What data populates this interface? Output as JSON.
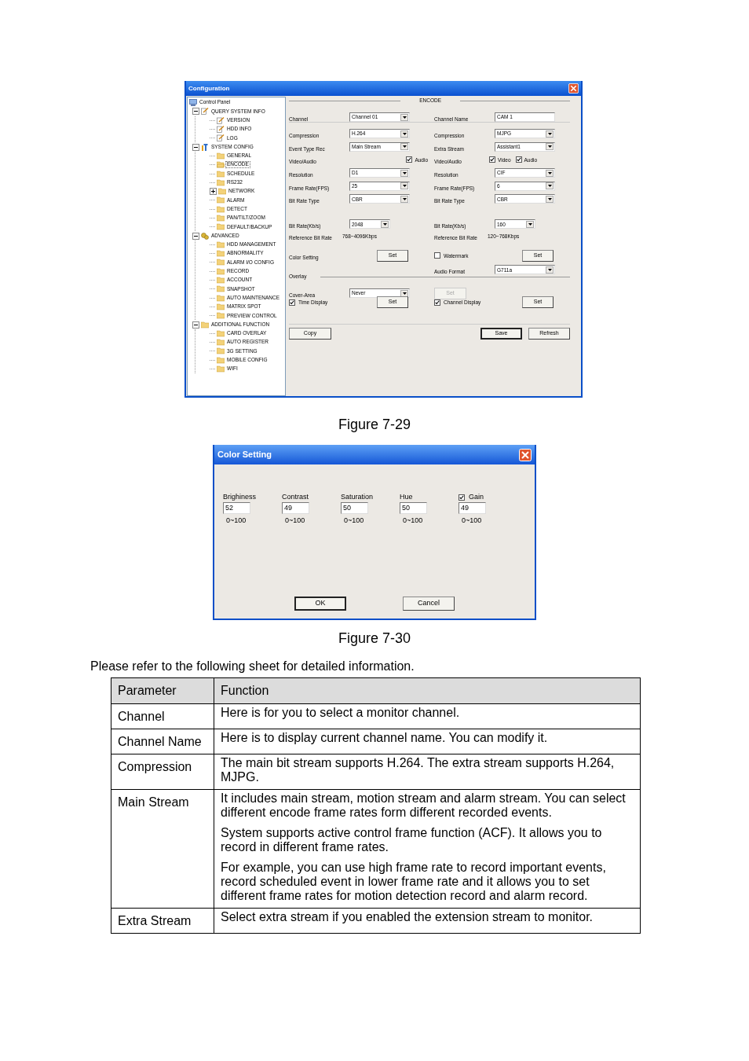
{
  "config_window": {
    "title": "Configuration",
    "tree": [
      {
        "label": "Control Panel",
        "kind": "monitor",
        "selected": false,
        "children": [
          {
            "label": "QUERY SYSTEM INFO",
            "kind": "doc",
            "expanded": true,
            "selected": false,
            "children": [
              {
                "label": "VERSION",
                "kind": "doc",
                "selected": false
              },
              {
                "label": "HDD INFO",
                "kind": "doc",
                "selected": false
              },
              {
                "label": "LOG",
                "kind": "doc",
                "selected": false
              }
            ]
          },
          {
            "label": "SYSTEM CONFIG",
            "kind": "tool",
            "expanded": true,
            "selected": false,
            "children": [
              {
                "label": "GENERAL",
                "kind": "folder",
                "selected": false
              },
              {
                "label": "ENCODE",
                "kind": "folder",
                "selected": true
              },
              {
                "label": "SCHEDULE",
                "kind": "folder",
                "selected": false
              },
              {
                "label": "RS232",
                "kind": "folder",
                "selected": false
              },
              {
                "label": "NETWORK",
                "kind": "folder",
                "expanded": false,
                "selected": false
              },
              {
                "label": "ALARM",
                "kind": "folder",
                "selected": false
              },
              {
                "label": "DETECT",
                "kind": "folder",
                "selected": false
              },
              {
                "label": "PAN/TILT/ZOOM",
                "kind": "folder",
                "selected": false
              },
              {
                "label": "DEFAULT/BACKUP",
                "kind": "folder",
                "selected": false
              }
            ]
          },
          {
            "label": "ADVANCED",
            "kind": "gear",
            "expanded": true,
            "selected": false,
            "children": [
              {
                "label": "HDD MANAGEMENT",
                "kind": "folder",
                "selected": false
              },
              {
                "label": "ABNORMALITY",
                "kind": "folder",
                "selected": false
              },
              {
                "label": "ALARM I/O CONFIG",
                "kind": "folder",
                "selected": false
              },
              {
                "label": "RECORD",
                "kind": "folder",
                "selected": false
              },
              {
                "label": "ACCOUNT",
                "kind": "folder",
                "selected": false
              },
              {
                "label": "SNAPSHOT",
                "kind": "folder",
                "selected": false
              },
              {
                "label": "AUTO MAINTENANCE",
                "kind": "folder",
                "selected": false
              },
              {
                "label": "MATRIX SPOT",
                "kind": "folder",
                "selected": false
              },
              {
                "label": "PREVIEW CONTROL",
                "kind": "folder",
                "selected": false
              }
            ]
          },
          {
            "label": "ADDITIONAL FUNCTION",
            "kind": "folder",
            "expanded": true,
            "selected": false,
            "children": [
              {
                "label": "CARD OVERLAY",
                "kind": "folder",
                "selected": false
              },
              {
                "label": "AUTO REGISTER",
                "kind": "folder",
                "selected": false
              },
              {
                "label": "3G SETTING",
                "kind": "folder",
                "selected": false
              },
              {
                "label": "MOBILE CONFIG",
                "kind": "folder",
                "selected": false
              },
              {
                "label": "WIFI",
                "kind": "folder",
                "selected": false
              }
            ]
          }
        ]
      }
    ],
    "encode": {
      "title": "ENCODE",
      "header_rows": [
        {
          "left": {
            "kind": "select",
            "label": "Channel",
            "value": "Channel 01"
          },
          "right": {
            "kind": "text",
            "label": "Channel Name",
            "value": "CAM 1"
          }
        }
      ],
      "stream_rows": [
        {
          "left": {
            "kind": "select",
            "label": "Compression",
            "value": "H.264"
          },
          "right": {
            "kind": "select",
            "label": "Compression",
            "value": "MJPG"
          }
        },
        {
          "left": {
            "kind": "select",
            "label": "Event Type Rec",
            "value": "Main Stream"
          },
          "right": {
            "kind": "select",
            "label": "Extra Stream",
            "value": "Assistant1"
          }
        },
        {
          "left": {
            "kind": "checks",
            "label": "Video/Audio",
            "checks": [
              {
                "label": "Audio",
                "checked": true
              }
            ]
          },
          "right": {
            "kind": "checks",
            "label": "Video/Audio",
            "checks": [
              {
                "label": "Video",
                "checked": true
              },
              {
                "label": "Audio",
                "checked": true
              }
            ]
          }
        },
        {
          "left": {
            "kind": "select",
            "label": "Resolution",
            "value": "D1"
          },
          "right": {
            "kind": "select",
            "label": "Resolution",
            "value": "CIF"
          }
        },
        {
          "left": {
            "kind": "select",
            "label": "Frame Rate(FPS)",
            "value": "25"
          },
          "right": {
            "kind": "select",
            "label": "Frame Rate(FPS)",
            "value": "6"
          }
        },
        {
          "left": {
            "kind": "select",
            "label": "Bit Rate Type",
            "value": "CBR"
          },
          "right": {
            "kind": "select",
            "label": "Bit Rate Type",
            "value": "CBR"
          }
        }
      ],
      "bitrate_rows": [
        {
          "left": {
            "kind": "short_select",
            "label": "Bit Rate(Kb/s)",
            "value": "2048"
          },
          "right": {
            "kind": "short_select",
            "label": "Bit Rate(Kb/s)",
            "value": "160"
          }
        },
        {
          "left": {
            "kind": "static",
            "label": "Reference Bit Rate",
            "value": "768~4096Kbps"
          },
          "right": {
            "kind": "static",
            "label": "Reference Bit Rate",
            "value": "120~768Kbps"
          }
        }
      ],
      "option_rows": [
        {
          "left": {
            "kind": "button",
            "label": "Color Setting",
            "button": {
              "label": "Set",
              "disabled": false
            }
          },
          "right": {
            "kind": "check_button",
            "label": "Watermark",
            "checked": false,
            "button": {
              "label": "Set",
              "disabled": false
            }
          }
        },
        {
          "right": {
            "kind": "select",
            "label": "Audio Format",
            "value": "G711a"
          }
        }
      ],
      "overlay": {
        "title": "Overlay",
        "rows": [
          {
            "left": {
              "kind": "select",
              "label": "Cover-Area",
              "value": "Never"
            },
            "right": {
              "kind": "button_only",
              "button": {
                "label": "Set",
                "disabled": true
              }
            }
          },
          {
            "left": {
              "kind": "check_button",
              "label": "Time Display",
              "checked": true,
              "button": {
                "label": "Set",
                "disabled": false
              }
            },
            "right": {
              "kind": "check_button",
              "label": "Channel Display",
              "checked": true,
              "button": {
                "label": "Set",
                "disabled": false
              }
            }
          }
        ]
      },
      "footer": {
        "left": [
          {
            "label": "Copy",
            "default": false
          }
        ],
        "right": [
          {
            "label": "Save",
            "default": true
          },
          {
            "label": "Refresh",
            "default": false
          }
        ]
      }
    }
  },
  "caption_1": "Figure 7-29",
  "color_dialog": {
    "title": "Color Setting",
    "fields": [
      {
        "label": "Brighiness",
        "value": "52",
        "range": "0~100"
      },
      {
        "label": "Contrast",
        "value": "49",
        "range": "0~100"
      },
      {
        "label": "Saturation",
        "value": "50",
        "range": "0~100"
      },
      {
        "label": "Hue",
        "value": "50",
        "range": "0~100"
      },
      {
        "label": "Gain",
        "value": "49",
        "range": "0~100",
        "checked": true
      }
    ],
    "buttons": [
      {
        "label": "OK",
        "default": true
      },
      {
        "label": "Cancel",
        "default": false
      }
    ]
  },
  "caption_2": "Figure 7-30",
  "intro": "Please refer to the following sheet for detailed information.",
  "table": {
    "columns": [
      "Parameter",
      "Function"
    ],
    "rows": [
      {
        "parameter": "Channel",
        "function": [
          "Here is for you to select a monitor channel."
        ]
      },
      {
        "parameter": "Channel Name",
        "function": [
          "Here is to display current channel name. You can modify it."
        ]
      },
      {
        "parameter": "Compression",
        "function": [
          "The main bit stream supports H.264. The extra stream supports H.264, MJPG."
        ]
      },
      {
        "parameter": "Main Stream",
        "function": [
          "It includes main stream, motion stream and alarm stream. You can select different encode frame rates form different recorded events.",
          "System supports active control frame function (ACF). It allows you to record in different frame rates.",
          "For example, you can use high frame rate to record important events, record scheduled event in lower frame rate and it allows you to set different frame rates for motion detection record and alarm record."
        ]
      },
      {
        "parameter": "Extra Stream",
        "function": [
          "Select extra stream if you enabled the extension stream to monitor."
        ]
      }
    ]
  }
}
